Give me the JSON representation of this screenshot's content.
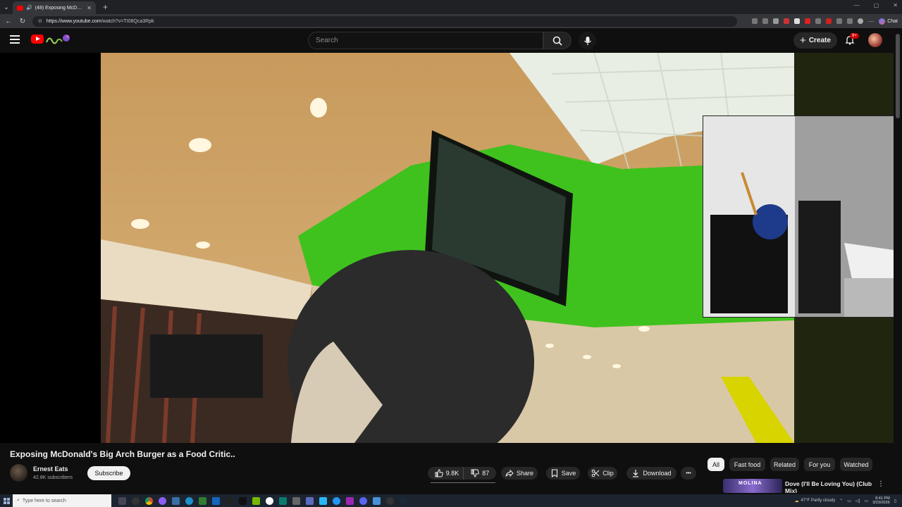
{
  "browser": {
    "tab_title": "(48) Exposing McDonald's Big ",
    "tab_close": "✕",
    "new_tab": "+",
    "url_host": "https://www.youtube.com",
    "url_path": "/watch?v=TI08Qca3Rpk",
    "chat_label": "Chat"
  },
  "header": {
    "search_placeholder": "Search",
    "create_label": "Create",
    "notifications_badge": "9+"
  },
  "video": {
    "title": "Exposing McDonald's Big Arch Burger as a Food Critic..",
    "channel": "Ernest Eats",
    "subscribers": "42.8K subscribers",
    "subscribe_label": "Subscribe"
  },
  "actions": {
    "likes": "9.8K",
    "dislikes": "87",
    "share": "Share",
    "save": "Save",
    "clip": "Clip",
    "download": "Download",
    "more": "•••"
  },
  "chips": [
    "All",
    "Fast food",
    "Related",
    "For you",
    "Watched"
  ],
  "recommended": {
    "thumb_text": "MOLINA",
    "title": "Dove (I'll Be Loving You) (Club Mix)"
  },
  "taskbar": {
    "search_placeholder": "Type here to search",
    "weather": "47°F  Partly cloudy",
    "time": "8:41 PM",
    "date": "3/23/2026"
  },
  "colors": {
    "youtube_red": "#ff0000",
    "background": "#0f0f0f",
    "pill": "#272727"
  }
}
